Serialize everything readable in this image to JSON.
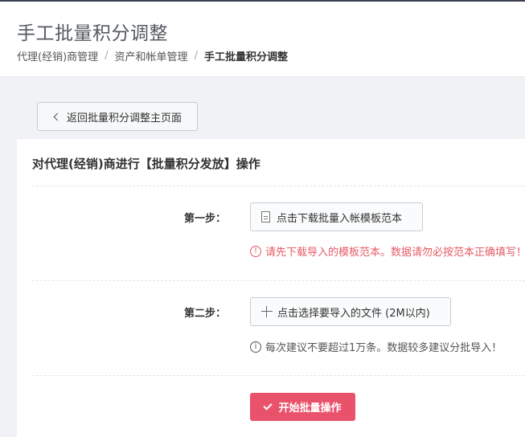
{
  "header": {
    "title": "手工批量积分调整",
    "breadcrumb": [
      "代理(经销)商管理",
      "资产和帐单管理",
      "手工批量积分调整"
    ],
    "breadcrumb_separator": "/"
  },
  "back_button": {
    "label": "返回批量积分调整主页面"
  },
  "panel": {
    "title": "对代理(经销)商进行【批量积分发放】操作",
    "step1": {
      "label": "第一步：",
      "button_label": "点击下载批量入帐模板范本",
      "hint": "请先下载导入的模板范本。数据请勿必按范本正确填写！"
    },
    "step2": {
      "label": "第二步：",
      "button_label": "点击选择要导入的文件 (2M以内)",
      "hint": "每次建议不要超过1万条。数据较多建议分批导入！"
    },
    "start_button": {
      "label": "开始批量操作"
    }
  },
  "icons": {
    "back": "chevron-left-icon",
    "download": "document-icon",
    "select_file": "plus-icon",
    "warning": "alert-circle-icon",
    "info": "info-circle-icon",
    "start": "check-icon"
  },
  "colors": {
    "accent": "#e9526a",
    "warning_text": "#e45b64",
    "top_bar": "#3a3f51",
    "background": "#f0f2f5"
  }
}
